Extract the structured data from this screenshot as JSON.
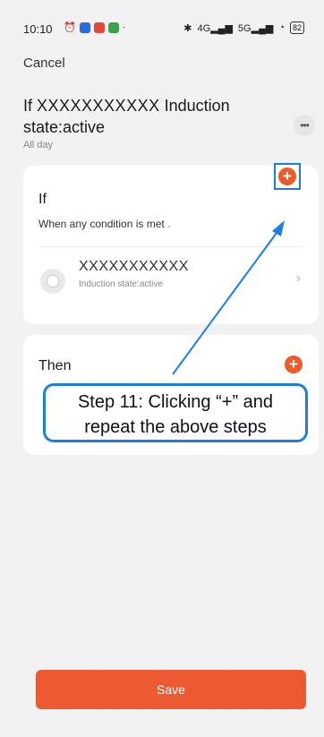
{
  "status": {
    "time": "10:10",
    "battery": "82",
    "signal_left_1": "4G",
    "signal_left_2": "5G"
  },
  "header": {
    "cancel_label": "Cancel"
  },
  "title": {
    "prefix": "If ",
    "masked_device": "XXXXXXXXXXX",
    "suffix": " Induction state:active",
    "subtitle": "All day"
  },
  "if_card": {
    "title": "If",
    "condition_mode": "When any condition is met",
    "device": {
      "name": "XXXXXXXXXXX",
      "state": "Induction state:active"
    }
  },
  "then_card": {
    "title": "Then"
  },
  "annotation": {
    "line1": "Step 11: Clicking “+” and",
    "line2": "repeat the above steps"
  },
  "footer": {
    "save_label": "Save"
  },
  "colors": {
    "accent": "#ec5a31",
    "callout": "#1d7ee0"
  },
  "icons": [
    "alarm-icon",
    "bluetooth-icon",
    "wifi-icon",
    "more-icon",
    "plus-icon",
    "chevron-right-icon",
    "device-icon"
  ]
}
